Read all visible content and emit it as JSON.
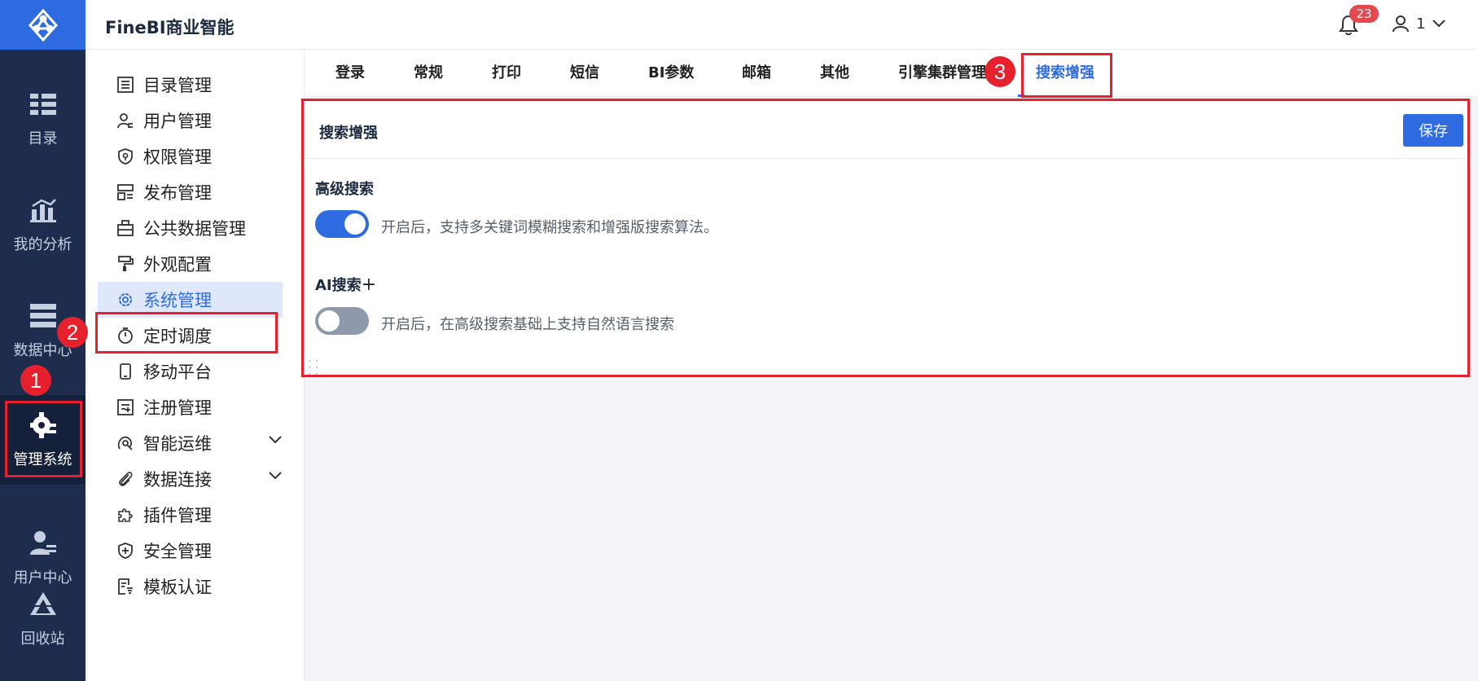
{
  "header": {
    "app_title": "FineBI商业智能",
    "notification_count": "23",
    "user_name": "1"
  },
  "leftnav": {
    "items": [
      {
        "label": "目录",
        "icon": "catalog-icon"
      },
      {
        "label": "我的分析",
        "icon": "analysis-chart-icon"
      },
      {
        "label": "数据中心",
        "icon": "data-center-icon"
      },
      {
        "label": "管理系统",
        "icon": "admin-gear-icon",
        "active": true
      },
      {
        "label": "用户中心",
        "icon": "user-center-icon"
      },
      {
        "label": "回收站",
        "icon": "recycle-bin-icon"
      }
    ]
  },
  "submenu": {
    "items": [
      {
        "label": "目录管理",
        "icon": "list-icon"
      },
      {
        "label": "用户管理",
        "icon": "user-manage-icon"
      },
      {
        "label": "权限管理",
        "icon": "permission-shield-icon"
      },
      {
        "label": "发布管理",
        "icon": "publish-icon"
      },
      {
        "label": "公共数据管理",
        "icon": "public-data-icon"
      },
      {
        "label": "外观配置",
        "icon": "paint-roller-icon"
      },
      {
        "label": "系统管理",
        "icon": "gear-icon",
        "active": true
      },
      {
        "label": "定时调度",
        "icon": "timer-icon"
      },
      {
        "label": "移动平台",
        "icon": "mobile-icon"
      },
      {
        "label": "注册管理",
        "icon": "register-icon"
      },
      {
        "label": "智能运维",
        "icon": "ops-icon",
        "expandable": true
      },
      {
        "label": "数据连接",
        "icon": "paperclip-icon",
        "expandable": true
      },
      {
        "label": "插件管理",
        "icon": "puzzle-icon"
      },
      {
        "label": "安全管理",
        "icon": "security-shield-icon"
      },
      {
        "label": "模板认证",
        "icon": "template-cert-icon"
      }
    ]
  },
  "tabs": [
    {
      "label": "登录"
    },
    {
      "label": "常规"
    },
    {
      "label": "打印"
    },
    {
      "label": "短信"
    },
    {
      "label": "BI参数"
    },
    {
      "label": "邮箱"
    },
    {
      "label": "其他"
    },
    {
      "label": "引擎集群管理"
    },
    {
      "label": "搜索增强",
      "active": true
    }
  ],
  "panel": {
    "title": "搜索增强",
    "save_label": "保存",
    "advanced_search": {
      "title": "高级搜索",
      "enabled": true,
      "description": "开启后，支持多关键词模糊搜索和增强版搜索算法。"
    },
    "ai_search": {
      "title": "AI搜索",
      "title_suffix": "+",
      "enabled": false,
      "description": "开启后，在高级搜索基础上支持自然语言搜索"
    }
  },
  "annotations": [
    "1",
    "2",
    "3"
  ],
  "colors": {
    "accent": "#2f6be0",
    "sidebar": "#1e2d4d",
    "annotation_red": "#e6202c"
  }
}
